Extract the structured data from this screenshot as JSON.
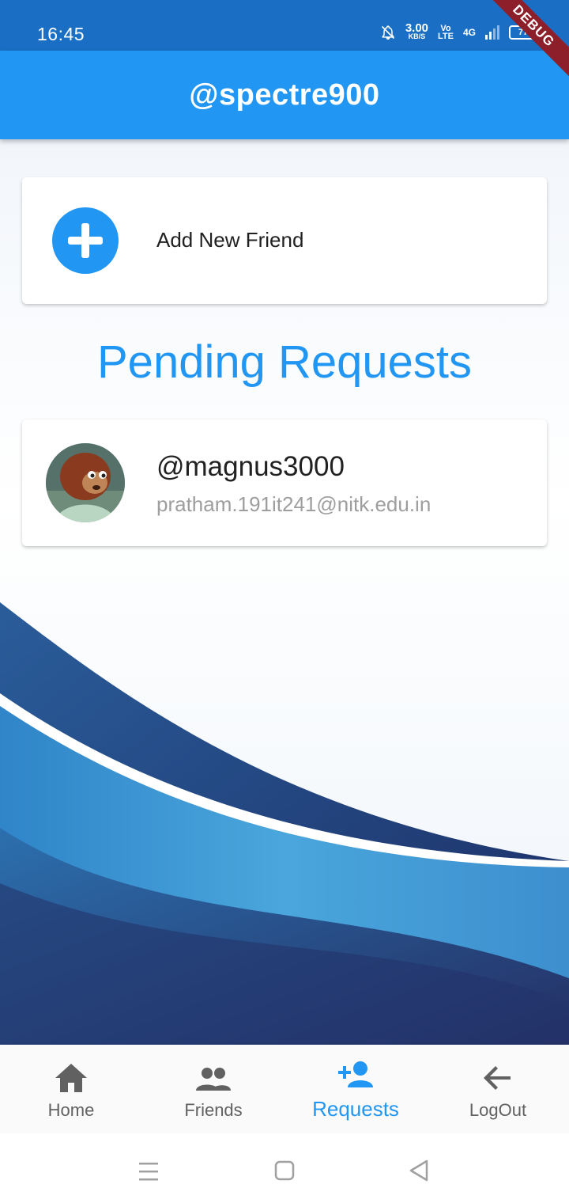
{
  "status_bar": {
    "time": "16:45",
    "net_speed_value": "3.00",
    "net_speed_unit": "KB/S",
    "volte_top": "Vo",
    "volte_bottom": "LTE",
    "network": "4G",
    "battery": "77"
  },
  "debug_banner": "DEBUG",
  "app_bar": {
    "title": "@spectre900"
  },
  "add_friend_card": {
    "label": "Add New Friend",
    "icon": "plus-circle-icon"
  },
  "pending": {
    "title": "Pending Requests",
    "requests": [
      {
        "username": "@magnus3000",
        "email": "pratham.191it241@nitk.edu.in"
      }
    ]
  },
  "bottom_nav": {
    "items": [
      {
        "label": "Home",
        "icon": "home-icon",
        "active": false
      },
      {
        "label": "Friends",
        "icon": "people-icon",
        "active": false
      },
      {
        "label": "Requests",
        "icon": "person-add-icon",
        "active": true
      },
      {
        "label": "LogOut",
        "icon": "arrow-back-icon",
        "active": false
      }
    ]
  },
  "colors": {
    "primary": "#2196f3",
    "status_bar": "#1a6fc4",
    "text_primary": "#212121",
    "text_secondary": "#9e9e9e",
    "nav_inactive": "#616161",
    "wave_dark": "#1e3a78"
  }
}
